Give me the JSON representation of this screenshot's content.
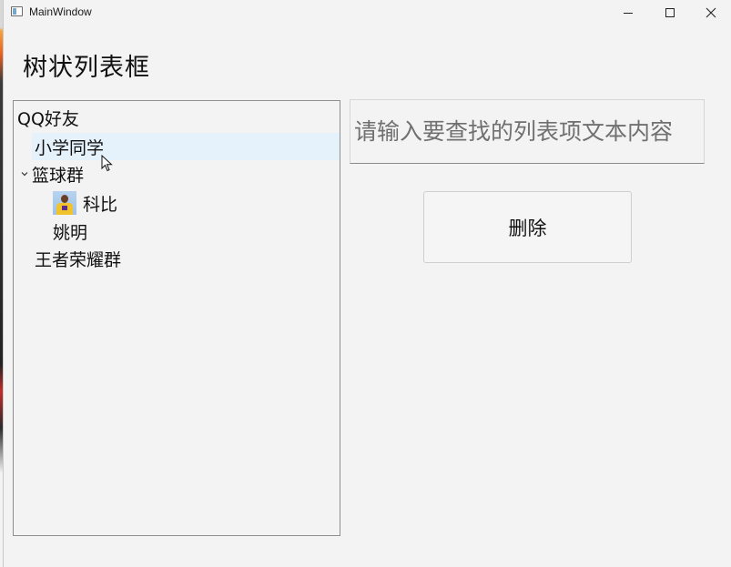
{
  "window": {
    "title": "MainWindow"
  },
  "heading": "树状列表框",
  "tree": {
    "root": "QQ好友",
    "items": [
      {
        "label": "小学同学",
        "selected": true
      },
      {
        "label": "篮球群",
        "expanded": true
      },
      {
        "label": "科比",
        "icon": "player-avatar-icon"
      },
      {
        "label": "姚明"
      },
      {
        "label": "王者荣耀群"
      }
    ]
  },
  "search": {
    "placeholder": "请输入要查找的列表项文本内容",
    "value": ""
  },
  "buttons": {
    "delete_label": "删除"
  },
  "colors": {
    "selection": "#e5f1fb",
    "window_bg": "#f3f3f3"
  }
}
